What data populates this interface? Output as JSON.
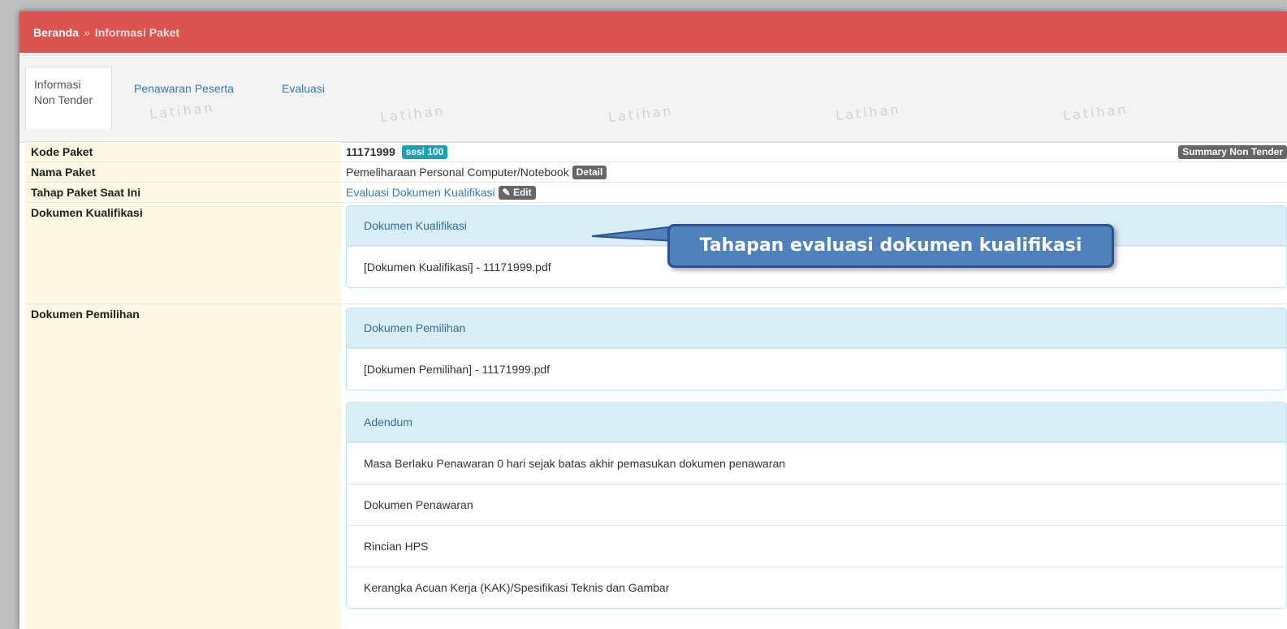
{
  "breadcrumb": {
    "home": "Beranda",
    "separator": "»",
    "current": "Informasi Paket"
  },
  "tabs": [
    {
      "line1": "Informasi",
      "line2": "Non Tender"
    },
    {
      "label": "Penawaran Peserta"
    },
    {
      "label": "Evaluasi"
    }
  ],
  "watermark": "Latihan",
  "fields": {
    "kode_label": "Kode Paket",
    "kode_value": "11171999",
    "sesi_badge": "sesi 100",
    "summary_button": "Summary Non Tender",
    "nama_label": "Nama Paket",
    "nama_value": "Pemeliharaan Personal Computer/Notebook",
    "detail_button": "Detail",
    "tahap_label": "Tahap Paket Saat Ini",
    "tahap_value": "Evaluasi Dokumen Kualifikasi",
    "edit_button": "Edit",
    "dok_kual_label": "Dokumen Kualifikasi",
    "dok_pemilihan_label": "Dokumen Pemilihan"
  },
  "panels": {
    "kualifikasi": {
      "title": "Dokumen Kualifikasi",
      "items": [
        "[Dokumen Kualifikasi] - 11171999.pdf"
      ]
    },
    "pemilihan": {
      "title": "Dokumen Pemilihan",
      "items": [
        "[Dokumen Pemilihan] - 11171999.pdf"
      ]
    },
    "adendum": {
      "title": "Adendum",
      "items": [
        "Masa Berlaku Penawaran 0 hari sejak batas akhir pemasukan dokumen penawaran",
        "Dokumen Penawaran",
        "Rincian HPS",
        "Kerangka Acuan Kerja (KAK)/Spesifikasi Teknis dan Gambar"
      ]
    }
  },
  "callout": "Tahapan evaluasi dokumen kualifikasi",
  "colors": {
    "header": "#d9534f",
    "label_bg": "#fcf8e3",
    "panel_head": "#d9edf7",
    "callout": "#4f81bd",
    "link": "#337ab7"
  }
}
